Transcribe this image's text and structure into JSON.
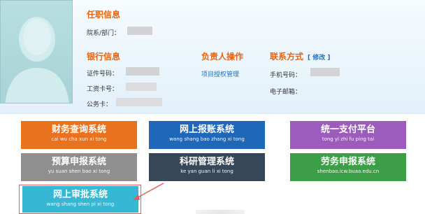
{
  "profile": {
    "position_section": {
      "title": "任职信息",
      "dept_label": "院系/部门："
    },
    "bank_section": {
      "title": "银行信息",
      "fields": [
        {
          "label": "证件号码："
        },
        {
          "label": "工资卡号："
        },
        {
          "label": "公务卡："
        }
      ]
    },
    "manager_section": {
      "title": "负责人操作",
      "link": "项目授权管理"
    },
    "contact_section": {
      "title": "联系方式",
      "edit_link": "[ 修改 ]",
      "phone_label": "手机号码：",
      "email_label": "电子邮箱："
    }
  },
  "systems": [
    {
      "label": "财务查询系统",
      "sub": "cai wu cha xun xi tong",
      "color": "#e8721e"
    },
    {
      "label": "网上报账系统",
      "sub": "wang shang bao zhang xi tong",
      "color": "#1f67b8"
    },
    {
      "label": "统一支付平台",
      "sub": "tong yi zhi fu ping tai",
      "color": "#9b5cbe"
    },
    {
      "label": "预算申报系统",
      "sub": "yu suan shen bao xi tong",
      "color": "#8f8f8f"
    },
    {
      "label": "科研管理系统",
      "sub": "ke yan guan li xi tong",
      "color": "#36475a"
    },
    {
      "label": "劳务申报系统",
      "sub": "shenbao.icw.buaa.edu.cn",
      "color": "#3c9e46"
    },
    {
      "label": "网上审批系统",
      "sub": "wang shang shen pi xi tong",
      "color": "#36b7d3"
    }
  ],
  "colors": {
    "section_title": "#e8640c",
    "link": "#1e6fc4",
    "annotation": "#e65b5b"
  }
}
